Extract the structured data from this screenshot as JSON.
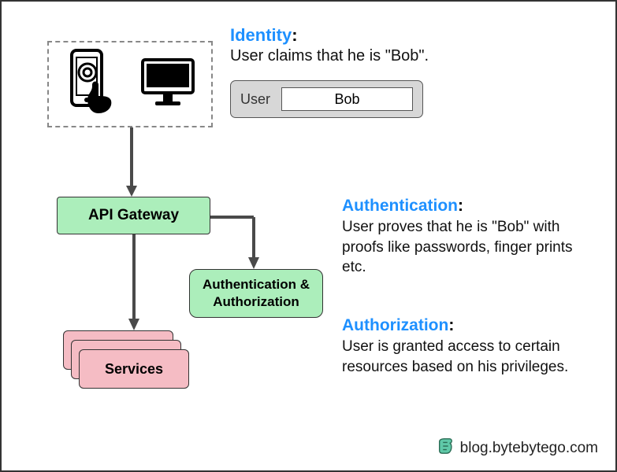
{
  "identity": {
    "title": "Identity",
    "description": "User claims that he is \"Bob\".",
    "chip": {
      "label": "User",
      "value": "Bob"
    }
  },
  "gateway": {
    "label": "API Gateway"
  },
  "auth_box": {
    "label": "Authentication &\nAuthorization"
  },
  "services": {
    "label": "Services"
  },
  "authentication": {
    "title": "Authentication",
    "description": "User proves that he is \"Bob\" with proofs like passwords, finger prints etc."
  },
  "authorization": {
    "title": "Authorization",
    "description": "User is granted access to certain resources based on his privileges."
  },
  "footer": {
    "text": "blog.bytebytego.com"
  }
}
